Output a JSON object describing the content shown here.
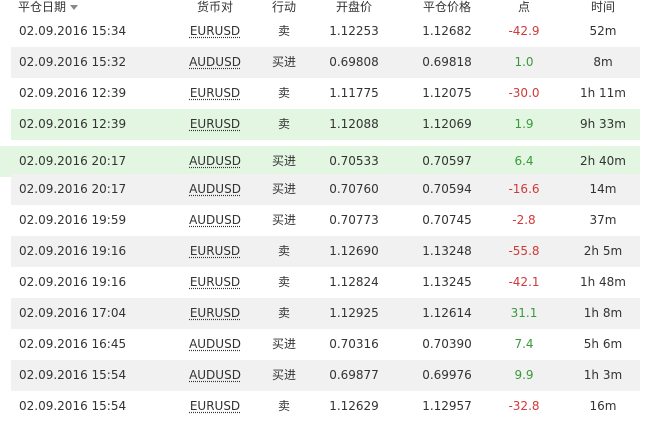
{
  "header": {
    "close_date": "平仓日期",
    "pair": "货币对",
    "action": "行动",
    "open_price": "开盘价",
    "close_price": "平仓价格",
    "points": "点",
    "time": "时间"
  },
  "colors": {
    "positive": "#3a9a3a",
    "negative": "#d03a3a",
    "highlight": "#e2f6e2",
    "stripe": "#f1f1f1"
  },
  "rows": [
    {
      "date": "02.09.2016 15:34",
      "pair": "EURUSD",
      "action": "卖",
      "open": "1.12253",
      "close": "1.12682",
      "points": "-42.9",
      "time": "52m"
    },
    {
      "date": "02.09.2016 15:32",
      "pair": "AUDUSD",
      "action": "买进",
      "open": "0.69808",
      "close": "0.69818",
      "points": "1.0",
      "time": "8m"
    },
    {
      "date": "02.09.2016 12:39",
      "pair": "EURUSD",
      "action": "卖",
      "open": "1.11775",
      "close": "1.12075",
      "points": "-30.0",
      "time": "1h 11m"
    },
    {
      "date": "02.09.2016 12:39",
      "pair": "EURUSD",
      "action": "卖",
      "open": "1.12088",
      "close": "1.12069",
      "points": "1.9",
      "time": "9h 33m"
    },
    {
      "date": "02.09.2016 20:17",
      "pair": "AUDUSD",
      "action": "买进",
      "open": "0.70533",
      "close": "0.70597",
      "points": "6.4",
      "time": "2h 40m"
    },
    {
      "date": "02.09.2016 20:17",
      "pair": "AUDUSD",
      "action": "买进",
      "open": "0.70760",
      "close": "0.70594",
      "points": "-16.6",
      "time": "14m"
    },
    {
      "date": "02.09.2016 19:59",
      "pair": "AUDUSD",
      "action": "买进",
      "open": "0.70773",
      "close": "0.70745",
      "points": "-2.8",
      "time": "37m"
    },
    {
      "date": "02.09.2016 19:16",
      "pair": "EURUSD",
      "action": "卖",
      "open": "1.12690",
      "close": "1.13248",
      "points": "-55.8",
      "time": "2h 5m"
    },
    {
      "date": "02.09.2016 19:16",
      "pair": "EURUSD",
      "action": "卖",
      "open": "1.12824",
      "close": "1.13245",
      "points": "-42.1",
      "time": "1h 48m"
    },
    {
      "date": "02.09.2016 17:04",
      "pair": "EURUSD",
      "action": "卖",
      "open": "1.12925",
      "close": "1.12614",
      "points": "31.1",
      "time": "1h 8m"
    },
    {
      "date": "02.09.2016 16:45",
      "pair": "AUDUSD",
      "action": "买进",
      "open": "0.70316",
      "close": "0.70390",
      "points": "7.4",
      "time": "5h 6m"
    },
    {
      "date": "02.09.2016 15:54",
      "pair": "AUDUSD",
      "action": "买进",
      "open": "0.69877",
      "close": "0.69976",
      "points": "9.9",
      "time": "1h 3m"
    },
    {
      "date": "02.09.2016 15:54",
      "pair": "EURUSD",
      "action": "卖",
      "open": "1.12629",
      "close": "1.12957",
      "points": "-32.8",
      "time": "16m"
    }
  ]
}
